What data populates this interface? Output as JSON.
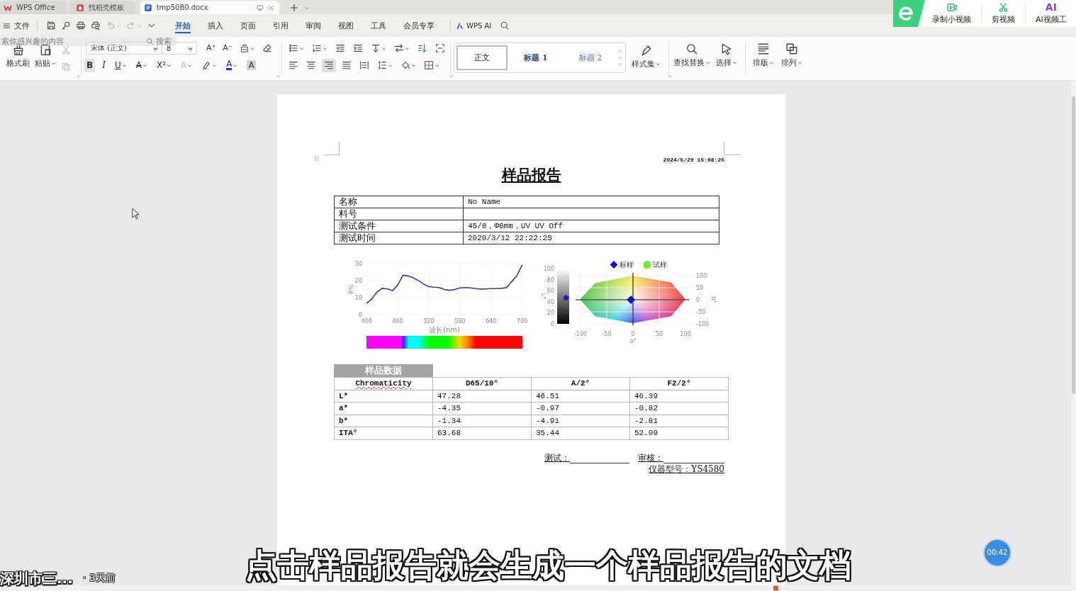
{
  "tabs": [
    {
      "kind": "wps",
      "label": "WPS Office",
      "selected": false
    },
    {
      "kind": "docer",
      "label": "找稻壳模板",
      "selected": false
    },
    {
      "kind": "doc",
      "label": "tmp50B0.docx",
      "selected": true
    }
  ],
  "video_tools": [
    {
      "kind": "record",
      "label": "录制小视频"
    },
    {
      "kind": "cut",
      "label": "剪视频"
    },
    {
      "kind": "ai",
      "badge": "AI",
      "label": "AI视频工"
    }
  ],
  "menu": {
    "file_label": "文件",
    "quick_tools": [
      {
        "kind": "save",
        "disabled": false,
        "dropdown": false
      },
      {
        "kind": "key",
        "disabled": false,
        "dropdown": false
      },
      {
        "kind": "print",
        "disabled": false,
        "dropdown": false
      },
      {
        "kind": "preview",
        "disabled": false,
        "dropdown": false
      },
      {
        "kind": "undo",
        "disabled": true,
        "dropdown": true
      },
      {
        "kind": "redo",
        "disabled": true,
        "dropdown": true
      },
      {
        "kind": "more",
        "disabled": false,
        "dropdown": false
      }
    ],
    "tabs": [
      {
        "label": "开始",
        "selected": true
      },
      {
        "label": "插入",
        "selected": false
      },
      {
        "label": "页面",
        "selected": false
      },
      {
        "label": "引用",
        "selected": false
      },
      {
        "label": "审阅",
        "selected": false
      },
      {
        "label": "视图",
        "selected": false
      },
      {
        "label": "工具",
        "selected": false
      },
      {
        "label": "会员专享",
        "selected": false
      }
    ],
    "ai_label": "WPS AI"
  },
  "search_overlay": {
    "placeholder": "索你感兴趣的内容",
    "button": "搜索"
  },
  "ribbon": {
    "clipboard": [
      {
        "kind": "brush",
        "label": "格式刷",
        "dropdown": false
      },
      {
        "kind": "paste",
        "label": "粘贴",
        "dropdown": true
      }
    ],
    "clip_small": [
      {
        "kind": "cut",
        "disabled": true
      },
      {
        "kind": "copy",
        "disabled": true
      }
    ],
    "font": {
      "name": "宋体 (正文)",
      "size": "8"
    },
    "font_row1": [
      {
        "kind": "grow",
        "label": "A⁺",
        "dropdown": false
      },
      {
        "kind": "shrink",
        "label": "A⁻",
        "dropdown": false
      },
      {
        "kind": "phonetic",
        "dropdown": true
      },
      {
        "kind": "eraser",
        "dropdown": false
      }
    ],
    "font_row2": [
      {
        "kind": "bold",
        "label": "B",
        "selected": true,
        "dropdown": false
      },
      {
        "kind": "italic",
        "label": "I",
        "selected": false,
        "dropdown": false
      },
      {
        "kind": "underline",
        "label": "U",
        "selected": false,
        "dropdown": true
      },
      {
        "kind": "strike",
        "label": "A",
        "selected": false,
        "dropdown": true
      },
      {
        "kind": "superscript",
        "label": "X²",
        "selected": false,
        "dropdown": true
      },
      {
        "kind": "effect",
        "label": "A",
        "selected": false,
        "dropdown": true
      },
      {
        "kind": "highlight",
        "selected": false,
        "dropdown": true
      },
      {
        "kind": "fontcolor",
        "label": "A",
        "selected": false,
        "dropdown": true
      },
      {
        "kind": "shading",
        "label": "A",
        "selected": false,
        "dropdown": false
      }
    ],
    "para_row1": [
      {
        "kind": "bullets",
        "dropdown": true
      },
      {
        "kind": "numbering",
        "dropdown": true
      },
      {
        "kind": "outdent",
        "dropdown": false
      },
      {
        "kind": "indent",
        "dropdown": false
      },
      {
        "kind": "direction",
        "dropdown": true
      },
      {
        "kind": "swap",
        "dropdown": true
      },
      {
        "kind": "sort",
        "dropdown": false
      },
      {
        "kind": "charborder",
        "dropdown": false
      }
    ],
    "para_row2": [
      {
        "kind": "align-left",
        "selected": false,
        "dropdown": false
      },
      {
        "kind": "align-center",
        "selected": false,
        "dropdown": false
      },
      {
        "kind": "align-right",
        "selected": true,
        "dropdown": false
      },
      {
        "kind": "justify",
        "selected": false,
        "dropdown": false
      },
      {
        "kind": "distribute",
        "selected": false,
        "dropdown": false
      },
      {
        "kind": "spacing",
        "selected": false,
        "dropdown": true
      },
      {
        "kind": "shading",
        "selected": false,
        "dropdown": true
      },
      {
        "kind": "border",
        "selected": false,
        "dropdown": true
      }
    ],
    "styles": [
      {
        "label": "正文",
        "selected": true
      },
      {
        "label": "标题 1",
        "selected": false
      },
      {
        "label": "标题 2",
        "selected": false
      }
    ],
    "style_set": {
      "kind": "styleset",
      "label": "样式集",
      "dropdown": true
    },
    "edit_tools": [
      {
        "kind": "find",
        "label": "查找替换",
        "dropdown": true
      },
      {
        "kind": "select",
        "label": "选择",
        "dropdown": true
      }
    ],
    "layout_tools": [
      {
        "kind": "layout",
        "label": "排版",
        "dropdown": true
      },
      {
        "kind": "arrange",
        "label": "排列",
        "dropdown": true
      }
    ]
  },
  "document": {
    "timestamp": "2024/5/29 15:08:26",
    "title": "样品报告",
    "info_rows": [
      {
        "label": "名称",
        "value": "No Name"
      },
      {
        "label": "料号"
      },
      {
        "label": "测试条件",
        "value": "45/0，Φ8mm，UV UV Off"
      },
      {
        "label": "测试时间",
        "value": "2020/3/12 22:22:25"
      }
    ],
    "spectrum_chart": {
      "chart_data": {
        "type": "line",
        "xlabel": "波长(nm)",
        "ylabel": "R%",
        "grid": true,
        "x": [
          400,
          410,
          420,
          430,
          440,
          450,
          460,
          470,
          480,
          490,
          500,
          510,
          520,
          530,
          540,
          550,
          560,
          570,
          580,
          590,
          600,
          610,
          620,
          630,
          640,
          650,
          660,
          670,
          680,
          690,
          700
        ],
        "xlim": [
          400,
          700
        ],
        "ylim": [
          0,
          30
        ],
        "xticks": [
          400,
          460,
          520,
          580,
          640,
          700
        ],
        "yticks": [
          0,
          10,
          20,
          30
        ],
        "series": [
          {
            "color": "#3a3ab8",
            "values": [
              6.8,
              9.3,
              13.4,
              15.5,
              15.2,
              14.2,
              17.5,
              23.2,
              22.8,
              21.7,
              20,
              18,
              16.5,
              16.2,
              16,
              14.8,
              14.4,
              14.8,
              15.8,
              16,
              15.8,
              15.4,
              15.1,
              15.2,
              15.4,
              15.4,
              15.5,
              16,
              19.6,
              23,
              29.3
            ]
          }
        ]
      }
    },
    "lightness_scale": {
      "label": "L*",
      "ticks": [
        "100",
        "80",
        "60",
        "40",
        "20",
        "0"
      ],
      "level": 0.47
    },
    "color_space_chart": {
      "chart_data": {
        "type": "scatter",
        "xlabel": "a*",
        "ylabel": "b*",
        "grid": true,
        "x": [
          -4
        ],
        "xlim": [
          -100,
          100
        ],
        "ylim": [
          -100,
          100
        ],
        "xticks": [
          -100,
          -50,
          0,
          50,
          100
        ],
        "yticks": [
          -100,
          -50,
          0,
          50,
          100
        ],
        "series": [
          {
            "name": "标样",
            "color": "#1010d0",
            "values": [
              0
            ]
          },
          {
            "name": "试样",
            "color": "#78e82a",
            "values": [
              null
            ]
          }
        ]
      }
    },
    "data_tab": "样品数据",
    "data_table": {
      "columns": [
        {
          "label": "Chromaticity",
          "misspelled": true
        },
        {
          "label": "D65/10°",
          "misspelled": false
        },
        {
          "label": "A/2°",
          "misspelled": false
        },
        {
          "label": "F2/2°",
          "misspelled": false
        }
      ],
      "rows": [
        {
          "label": "L*",
          "values": [
            "47.28",
            "46.51",
            "46.39"
          ]
        },
        {
          "label": "a*",
          "values": [
            "-4.35",
            "-0.97",
            "-0.82"
          ]
        },
        {
          "label": "b*",
          "values": [
            "-1.34",
            "-4.91",
            "-2.81"
          ]
        },
        {
          "label": "ITA°",
          "values": [
            "63.68",
            "35.44",
            "52.09"
          ]
        }
      ]
    },
    "signatures": [
      {
        "label": "测试："
      },
      {
        "label": "审核："
      }
    ],
    "instrument": "仪器型号：YS4580"
  },
  "subtitle": "点击样品报告就会生成一个样品报告的文档",
  "channel": {
    "name": "深圳市三...",
    "age": "· 3天前"
  },
  "timer": "00:42"
}
